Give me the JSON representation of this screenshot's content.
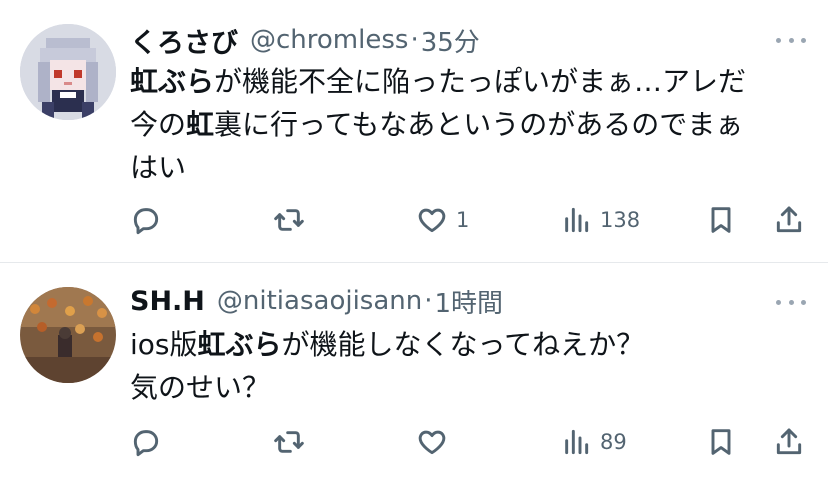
{
  "tweets": [
    {
      "name": "くろさび",
      "handle": "@chromless",
      "separator": "·",
      "time": "35分",
      "lines": [
        [
          {
            "t": "虹ぶら",
            "b": true
          },
          {
            "t": "が機能不全に陥ったっぽいがまぁ…アレだ",
            "b": false
          }
        ],
        [
          {
            "t": "今の",
            "b": false
          },
          {
            "t": "虹",
            "b": true
          },
          {
            "t": "裏に行ってもなあというのがあるのでまぁ",
            "b": false
          }
        ],
        [
          {
            "t": "はい",
            "b": false
          }
        ]
      ],
      "actions": {
        "reply": "",
        "retweet": "",
        "like": "1",
        "views": "138"
      },
      "avatar": "pixel-art-character-avatar"
    },
    {
      "name": "SH.H",
      "handle": "@nitiasaojisann",
      "separator": "·",
      "time": "1時間",
      "lines": [
        [
          {
            "t": "ios版",
            "b": false
          },
          {
            "t": "虹ぶら",
            "b": true
          },
          {
            "t": "が機能しなくなってねえか？",
            "b": false
          }
        ],
        [
          {
            "t": "気のせい？",
            "b": false
          }
        ]
      ],
      "actions": {
        "reply": "",
        "retweet": "",
        "like": "",
        "views": "89"
      },
      "avatar": "photo-avatar"
    }
  ],
  "icons": [
    "reply-icon",
    "retweet-icon",
    "like-icon",
    "views-icon",
    "bookmark-icon",
    "share-icon",
    "more-icon"
  ],
  "colors": {
    "text": "#0f1419",
    "secondary": "#536471",
    "divider": "#e6e9ec"
  }
}
